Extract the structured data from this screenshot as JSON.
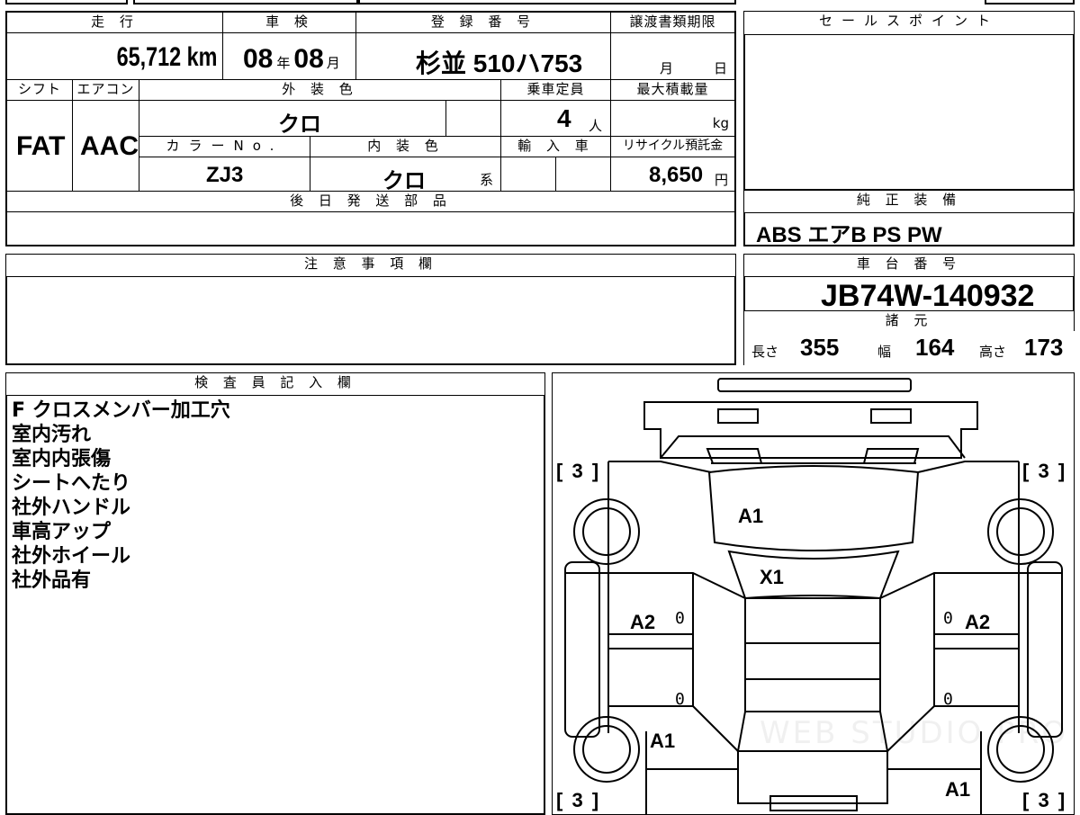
{
  "header": {
    "mileage_label": "走 行",
    "mileage_value": "65,712",
    "mileage_unit": "km",
    "inspection_label": "車 検",
    "inspection_year": "08",
    "inspection_year_unit": "年",
    "inspection_month": "08",
    "inspection_month_unit": "月",
    "registration_label": "登 録 番 号",
    "registration_value": "杉並 510ハ753",
    "transfer_deadline_label": "譲渡書類期限",
    "transfer_month_unit": "月",
    "transfer_day_unit": "日",
    "shift_label": "シフト",
    "shift_value": "FAT",
    "aircon_label": "エアコン",
    "aircon_value": "AAC",
    "exterior_color_label": "外 装 色",
    "exterior_color_value": "クロ",
    "capacity_label": "乗車定員",
    "capacity_value": "4",
    "capacity_unit": "人",
    "max_load_label": "最大積載量",
    "max_load_unit": "kg",
    "color_no_label": "カラーNo.",
    "color_no_value": "ZJ3",
    "interior_color_label": "内 装 色",
    "interior_color_value": "クロ",
    "interior_color_suffix": "系",
    "import_label": "輸 入 車",
    "recycle_label": "リサイクル預託金",
    "recycle_value": "8,650",
    "recycle_unit": "円",
    "later_parts_label": "後 日 発 送 部 品"
  },
  "sales_points": {
    "label": "セールスポイント"
  },
  "equipment": {
    "label": "純 正 装 備",
    "value": "ABS エアB PS PW"
  },
  "notes": {
    "label": "注 意 事 項 欄"
  },
  "chassis": {
    "label": "車 台 番 号",
    "value": "JB74W-140932"
  },
  "specs": {
    "label": "諸 元",
    "length_label": "長さ",
    "length_value": "355",
    "width_label": "幅",
    "width_value": "164",
    "height_label": "高さ",
    "height_value": "173"
  },
  "inspector": {
    "label": "検 査 員 記 入 欄",
    "lines": [
      "F クロスメンバー加工穴",
      "室内汚れ",
      "室内内張傷",
      "シートへたり",
      "社外ハンドル",
      "車高アップ",
      "社外ホイール",
      "社外品有"
    ]
  },
  "diagram": {
    "marks": {
      "hood": "A1",
      "roof_front": "X1",
      "left_front_door": "A2",
      "right_front_door": "A2",
      "left_rear": "A1",
      "right_rear": "A1",
      "left_front_door_num": "0",
      "right_front_door_num": "0",
      "left_rear_door_num": "0",
      "right_rear_door_num": "0"
    },
    "tire_marks": {
      "front_left": "3",
      "front_right": "3",
      "rear_left": "3",
      "rear_right": "3"
    },
    "watermark": "WEB STUDIO PRO"
  }
}
